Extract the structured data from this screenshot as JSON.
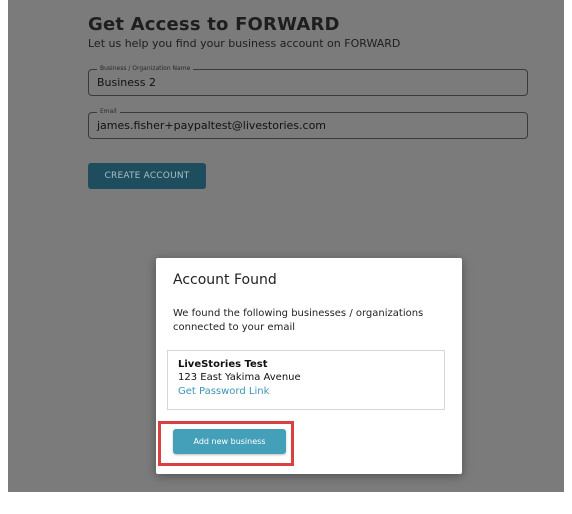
{
  "page": {
    "title": "Get Access to FORWARD",
    "subtitle": "Let us help you find your business account on FORWARD"
  },
  "form": {
    "business_field": {
      "label": "Business / Organization Name",
      "value": "Business 2"
    },
    "email_field": {
      "label": "Email",
      "value": "james.fisher+paypaltest@livestories.com"
    },
    "create_account_label": "CREATE ACCOUNT"
  },
  "modal": {
    "title": "Account Found",
    "message": "We found the following businesses / organizations connected to your email",
    "results": [
      {
        "name": "LiveStories Test",
        "address": "123 East Yakima Avenue",
        "link_label": "Get Password Link"
      }
    ],
    "add_button_label": "Add new business"
  },
  "colors": {
    "backdrop": "#7b7b7b",
    "create_button": "#1e4e5e",
    "primary_button": "#44a0b8",
    "link": "#3a95b8",
    "highlight_border": "#d9403f"
  }
}
